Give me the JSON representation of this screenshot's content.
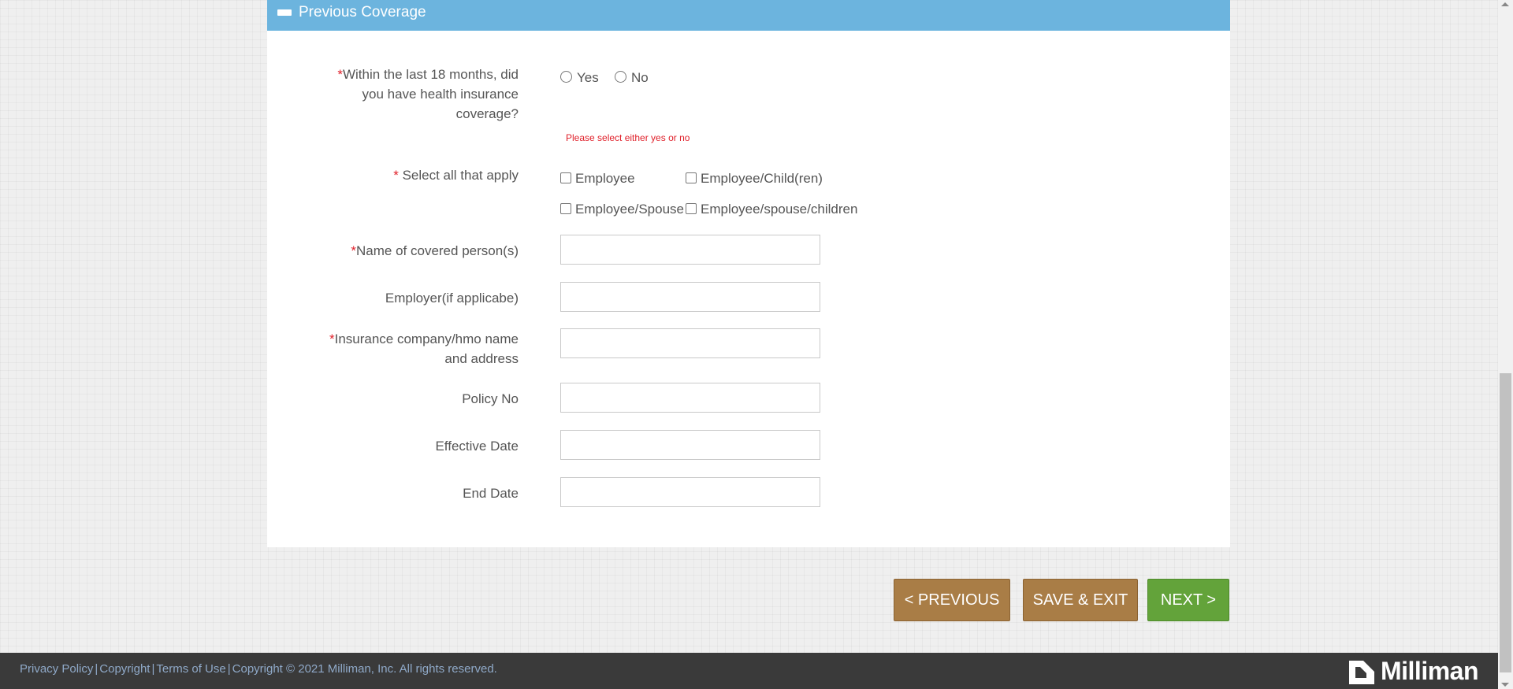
{
  "section": {
    "title": "Previous Coverage"
  },
  "coverage_question": {
    "required_mark": "*",
    "line1": "Within the last 18 months, did",
    "line2": "you have health insurance",
    "line3": "coverage?",
    "options": [
      "Yes",
      "No"
    ],
    "error": "Please select either yes or no"
  },
  "select_all": {
    "required_mark": "*",
    "label": " Select all that apply",
    "options": [
      "Employee",
      "Employee/Child(ren)",
      "Employee/Spouse",
      "Employee/spouse/children"
    ]
  },
  "fields": {
    "covered_person": {
      "required_mark": "*",
      "label": "Name of covered person(s)",
      "value": ""
    },
    "employer": {
      "label": "Employer(if applicabe)",
      "value": ""
    },
    "insurance_company": {
      "required_mark": "*",
      "line1": "Insurance company/hmo name",
      "line2": "and address",
      "value": ""
    },
    "policy_no": {
      "label": "Policy No",
      "value": ""
    },
    "effective_date": {
      "label": "Effective Date",
      "value": ""
    },
    "end_date": {
      "label": "End Date",
      "value": ""
    }
  },
  "buttons": {
    "previous": "< PREVIOUS",
    "save_exit": "SAVE & EXIT",
    "next": "NEXT >"
  },
  "footer": {
    "privacy": "Privacy Policy",
    "copyright": "Copyright",
    "terms": "Terms of Use",
    "notice": "Copyright © 2021 Milliman, Inc. All rights reserved.",
    "separator": "|",
    "brand": "Milliman"
  },
  "colors": {
    "header": "#6cb4de",
    "required": "#e0202a",
    "brown_button": "#a97d46",
    "green_button": "#63a33a",
    "footer_bg": "#3a3a3a",
    "footer_link": "#8fa9c8"
  }
}
